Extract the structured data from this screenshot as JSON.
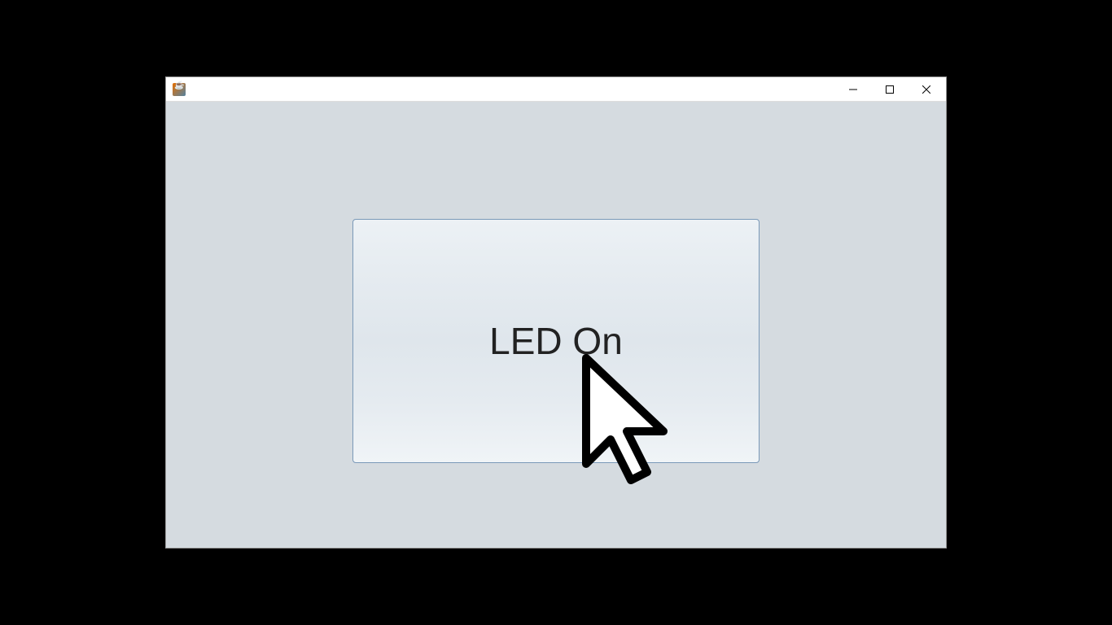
{
  "window": {
    "title": ""
  },
  "button": {
    "label": "LED On"
  }
}
